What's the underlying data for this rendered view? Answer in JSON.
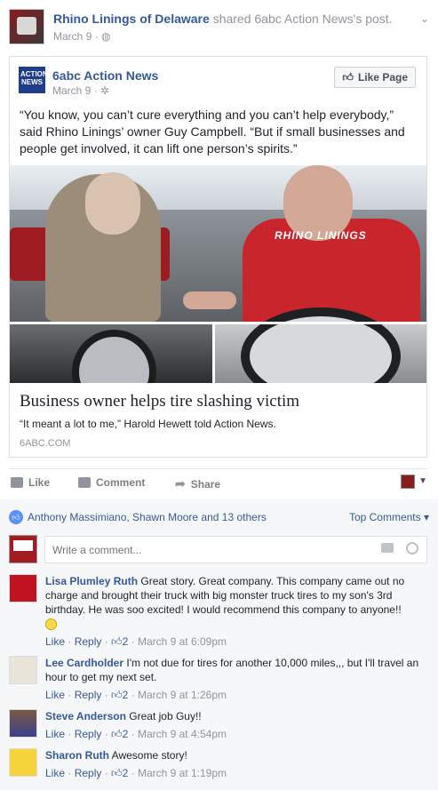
{
  "post": {
    "author": "Rhino Linings of Delaware",
    "shared_text": "shared 6abc Action News's post.",
    "date": "March 9",
    "privacy_icon": "globe-icon"
  },
  "shared": {
    "page_name": "6abc Action News",
    "date": "March 9",
    "like_page_label": "Like Page",
    "avatar_text": "ACTION NEWS",
    "quote": "“You know, you can’t cure everything and you can’t help everybody,” said Rhino Linings’ owner Guy Campbell. “But if small businesses and people get involved, it can lift one person’s spirits.”",
    "photo_logo_text": "RHINO LININGS",
    "link_title": "Business owner helps tire slashing victim",
    "link_desc": "“It meant a lot to me,” Harold Hewett told Action News.",
    "link_domain": "6ABC.COM"
  },
  "actions": {
    "like": "Like",
    "comment": "Comment",
    "share": "Share"
  },
  "reactions": {
    "people": "Anthony Massimiano, Shawn Moore and 13 others",
    "sort": "Top Comments ▾"
  },
  "composer": {
    "placeholder": "Write a comment..."
  },
  "comments": [
    {
      "name": "Lisa Plumley Ruth",
      "text": "Great story. Great company. This company came out no charge and brought their truck with big monster truck tires to my son's 3rd birthday. He was soo excited! I would recommend this company to anyone!!",
      "like": "Like",
      "reply": "Reply",
      "likes": "2",
      "time": "March 9 at 6:09pm"
    },
    {
      "name": "Lee Cardholder",
      "text": "I'm not due for tires for another 10,000 miles,,, but I'll travel an hour to get my next set.",
      "like": "Like",
      "reply": "Reply",
      "likes": "2",
      "time": "March 9 at 1:26pm"
    },
    {
      "name": "Steve Anderson",
      "text": "Great job Guy!!",
      "like": "Like",
      "reply": "Reply",
      "likes": "2",
      "time": "March 9 at 4:54pm"
    },
    {
      "name": "Sharon Ruth",
      "text": "Awesome story!",
      "like": "Like",
      "reply": "Reply",
      "likes": "2",
      "time": "March 9 at 1:19pm"
    }
  ]
}
